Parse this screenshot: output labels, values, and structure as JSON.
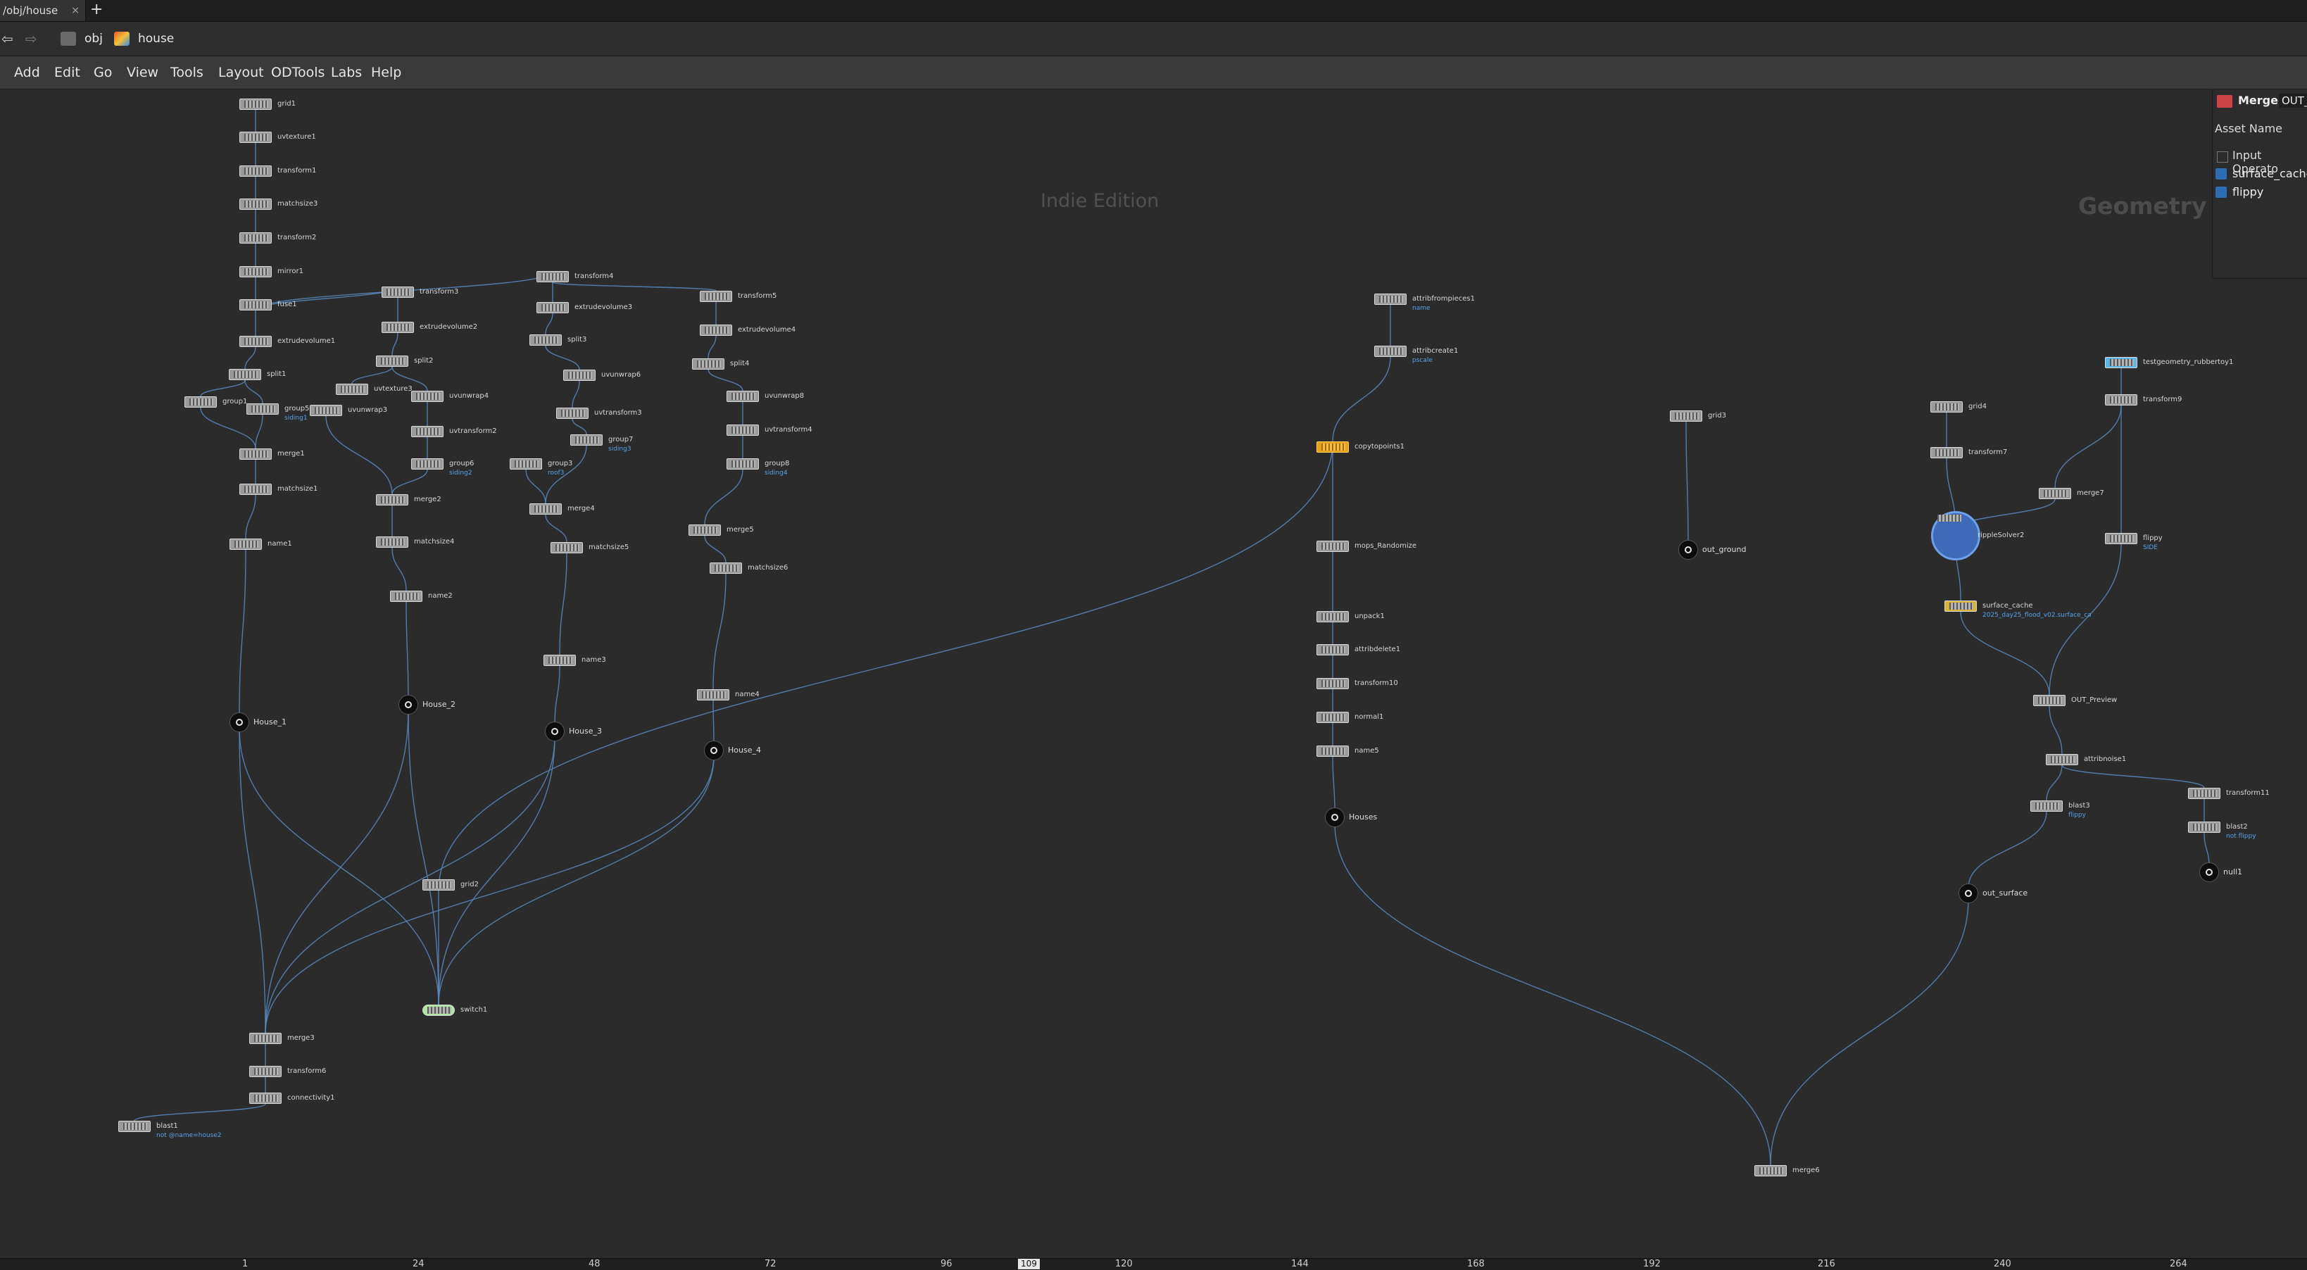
{
  "tab": {
    "title": "/obj/house",
    "close": "×",
    "add": "+"
  },
  "pathbar": {
    "back": "⇦",
    "forward": "⇨",
    "crumbs": [
      "obj",
      "house"
    ]
  },
  "menu": [
    "Add",
    "Edit",
    "Go",
    "View",
    "Tools",
    "Layout",
    "ODTools",
    "Labs",
    "Help"
  ],
  "network": {
    "edition_label": "Indie Edition",
    "context_label": "Geometry"
  },
  "nodes": [
    {
      "id": "grid1",
      "label": "grid1"
    },
    {
      "id": "uvtexture1",
      "label": "uvtexture1"
    },
    {
      "id": "transform1",
      "label": "transform1"
    },
    {
      "id": "matchsize3",
      "label": "matchsize3"
    },
    {
      "id": "transform2",
      "label": "transform2"
    },
    {
      "id": "mirror1",
      "label": "mirror1"
    },
    {
      "id": "fuse1",
      "label": "fuse1"
    },
    {
      "id": "extrudevolume1",
      "label": "extrudevolume1"
    },
    {
      "id": "split1",
      "label": "split1"
    },
    {
      "id": "group1",
      "label": "group1"
    },
    {
      "id": "group5",
      "label": "group5",
      "sub": "siding1"
    },
    {
      "id": "merge1",
      "label": "merge1"
    },
    {
      "id": "matchsize1",
      "label": "matchsize1"
    },
    {
      "id": "name1",
      "label": "name1"
    },
    {
      "id": "transform3",
      "label": "transform3"
    },
    {
      "id": "extrudevolume2",
      "label": "extrudevolume2"
    },
    {
      "id": "split2",
      "label": "split2"
    },
    {
      "id": "uvtexture3",
      "label": "uvtexture3"
    },
    {
      "id": "uvunwrap4",
      "label": "uvunwrap4"
    },
    {
      "id": "uvunwrap3",
      "label": "uvunwrap3"
    },
    {
      "id": "uvtransform2",
      "label": "uvtransform2"
    },
    {
      "id": "group6",
      "label": "group6",
      "sub": "siding2"
    },
    {
      "id": "merge2",
      "label": "merge2"
    },
    {
      "id": "matchsize4",
      "label": "matchsize4"
    },
    {
      "id": "name2",
      "label": "name2"
    },
    {
      "id": "transform4",
      "label": "transform4"
    },
    {
      "id": "extrudevolume3",
      "label": "extrudevolume3"
    },
    {
      "id": "split3",
      "label": "split3"
    },
    {
      "id": "uvunwrap6",
      "label": "uvunwrap6"
    },
    {
      "id": "uvtransform3",
      "label": "uvtransform3"
    },
    {
      "id": "group3",
      "label": "group3",
      "sub": "roof3"
    },
    {
      "id": "group7",
      "label": "group7",
      "sub": "siding3"
    },
    {
      "id": "merge4",
      "label": "merge4"
    },
    {
      "id": "matchsize5",
      "label": "matchsize5"
    },
    {
      "id": "name3",
      "label": "name3"
    },
    {
      "id": "transform5",
      "label": "transform5"
    },
    {
      "id": "extrudevolume4",
      "label": "extrudevolume4"
    },
    {
      "id": "split4",
      "label": "split4"
    },
    {
      "id": "uvunwrap8",
      "label": "uvunwrap8"
    },
    {
      "id": "uvtransform4",
      "label": "uvtransform4"
    },
    {
      "id": "group8",
      "label": "group8",
      "sub": "siding4"
    },
    {
      "id": "merge5",
      "label": "merge5"
    },
    {
      "id": "matchsize6",
      "label": "matchsize6"
    },
    {
      "id": "name4",
      "label": "name4"
    },
    {
      "id": "grid2",
      "label": "grid2"
    },
    {
      "id": "merge3",
      "label": "merge3"
    },
    {
      "id": "transform6",
      "label": "transform6"
    },
    {
      "id": "connectivity1",
      "label": "connectivity1"
    },
    {
      "id": "blast1",
      "label": "blast1",
      "sub": "not @name=house2"
    },
    {
      "id": "attribfrompieces1",
      "label": "attribfrompieces1",
      "sub": "name"
    },
    {
      "id": "attribcreate1",
      "label": "attribcreate1",
      "sub": "pscale"
    },
    {
      "id": "copytopoints1",
      "label": "copytopoints1"
    },
    {
      "id": "mops_Randomize",
      "label": "mops_Randomize"
    },
    {
      "id": "unpack1",
      "label": "unpack1"
    },
    {
      "id": "attribdelete1",
      "label": "attribdelete1"
    },
    {
      "id": "transform10",
      "label": "transform10"
    },
    {
      "id": "normal1",
      "label": "normal1"
    },
    {
      "id": "name5",
      "label": "name5"
    },
    {
      "id": "grid3",
      "label": "grid3"
    },
    {
      "id": "grid4",
      "label": "grid4"
    },
    {
      "id": "transform7",
      "label": "transform7"
    },
    {
      "id": "testgeometry_rubbertoy1",
      "label": "testgeometry_rubbertoy1"
    },
    {
      "id": "transform9",
      "label": "transform9"
    },
    {
      "id": "merge7",
      "label": "merge7"
    },
    {
      "id": "rippleSolver2",
      "label": "rippleSolver2"
    },
    {
      "id": "flippy",
      "label": "flippy",
      "sub": "SIDE"
    },
    {
      "id": "surface_cache",
      "label": "surface_cache",
      "sub": "2025_day25_flood_v02.surface_ca"
    },
    {
      "id": "OUT_Preview",
      "label": "OUT_Preview"
    },
    {
      "id": "attribnoise1",
      "label": "attribnoise1"
    },
    {
      "id": "blast3",
      "label": "blast3",
      "sub": "flippy"
    },
    {
      "id": "transform11",
      "label": "transform11"
    },
    {
      "id": "blast2",
      "label": "blast2",
      "sub": "not flippy"
    },
    {
      "id": "merge6",
      "label": "merge6"
    },
    {
      "id": "switch1",
      "label": "switch1"
    }
  ],
  "nulls": [
    {
      "id": "House_1",
      "label": "House_1"
    },
    {
      "id": "House_2",
      "label": "House_2"
    },
    {
      "id": "House_3",
      "label": "House_3"
    },
    {
      "id": "House_4",
      "label": "House_4"
    },
    {
      "id": "Houses",
      "label": "Houses"
    },
    {
      "id": "out_ground",
      "label": "out_ground"
    },
    {
      "id": "out_surface",
      "label": "out_surface"
    },
    {
      "id": "null1",
      "label": "null1"
    }
  ],
  "panel": {
    "title": "Merge",
    "name_field": "OUT_",
    "asset_label": "Asset Name",
    "inputs_header": "Input Operato",
    "inputs": [
      "surface_cache",
      "flippy"
    ]
  },
  "timeline": {
    "ticks": [
      "1",
      "24",
      "48",
      "72",
      "96",
      "120",
      "144",
      "168",
      "192",
      "216",
      "240",
      "264"
    ],
    "current_frame": "109"
  },
  "colors": {
    "background": "#2b2b2b",
    "wire": "#5a8ac0",
    "selected_node": "#e4a21c"
  }
}
